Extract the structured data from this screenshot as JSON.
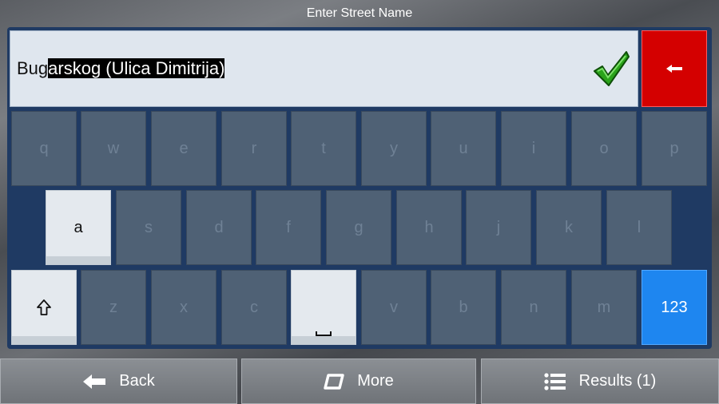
{
  "header": {
    "title": "Enter Street Name"
  },
  "search": {
    "typed": "Bug",
    "completion": "arskog (Ulica Dimitrija)"
  },
  "keyboard": {
    "row1": [
      "q",
      "w",
      "e",
      "r",
      "t",
      "y",
      "u",
      "i",
      "o",
      "p"
    ],
    "row2": [
      "a",
      "s",
      "d",
      "f",
      "g",
      "h",
      "j",
      "k",
      "l"
    ],
    "row3": [
      "z",
      "x",
      "c",
      "v",
      "b",
      "n",
      "m"
    ],
    "numeric_label": "123",
    "active_keys": [
      "a",
      "space",
      "shift"
    ]
  },
  "footer": {
    "back_label": "Back",
    "more_label": "More",
    "results_label": "Results (1)"
  },
  "colors": {
    "accent": "#1e86f0",
    "backspace": "#d40000",
    "panel": "#1f3a63",
    "check": "#2aa31a"
  },
  "icons": [
    "backspace-icon",
    "checkmark-icon",
    "shift-icon",
    "space-icon",
    "back-arrow-icon",
    "more-icon",
    "list-icon"
  ]
}
